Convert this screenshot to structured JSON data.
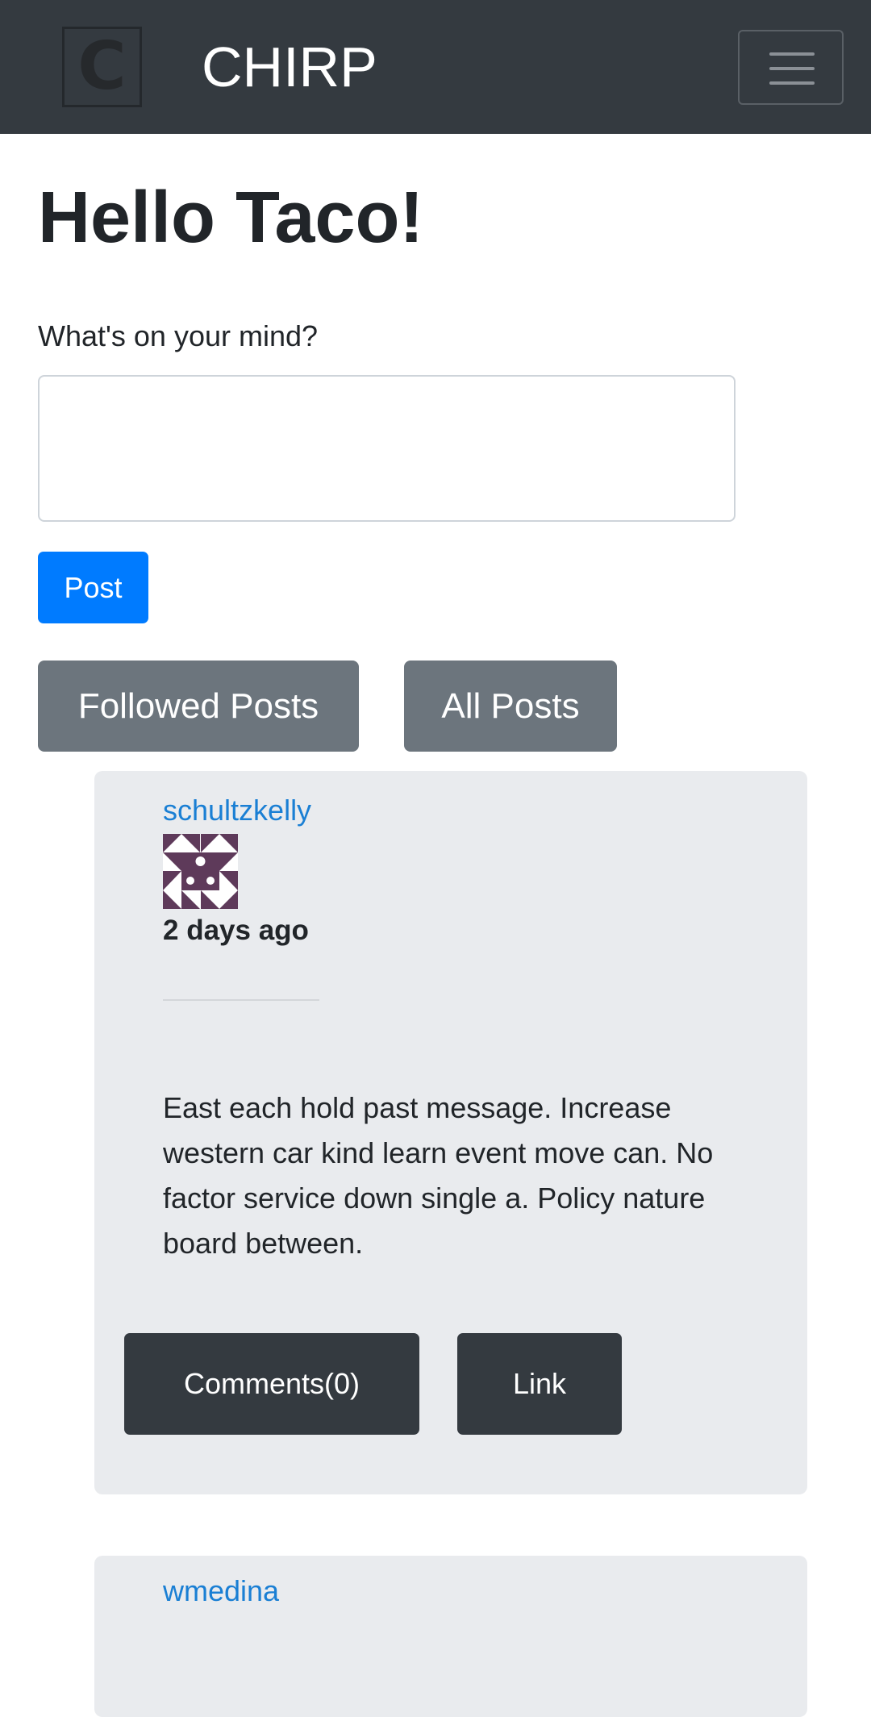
{
  "navbar": {
    "logo_letter": "C",
    "brand": "CHIRP"
  },
  "main": {
    "greeting": "Hello Taco!",
    "prompt_label": "What's on your mind?",
    "textarea_value": "",
    "post_button": "Post",
    "tabs": [
      {
        "label": "Followed Posts"
      },
      {
        "label": "All Posts"
      }
    ]
  },
  "posts": [
    {
      "username": "schultzkelly",
      "timestamp": "2 days ago",
      "avatar_color": "#5e3a5a",
      "body": "East each hold past message. Increase western car kind learn event move can. No factor service down single a. Policy nature board between.",
      "comments_label": "Comments(0)",
      "link_label": "Link"
    },
    {
      "username": "wmedina"
    }
  ]
}
